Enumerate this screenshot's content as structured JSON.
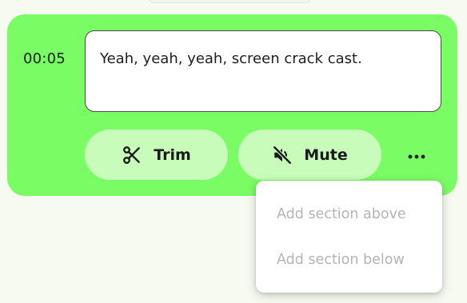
{
  "segment": {
    "timestamp": "00:05",
    "transcript": "Yeah, yeah, yeah, screen crack cast."
  },
  "actions": {
    "trim_label": "Trim",
    "trim_icon": "scissors-icon",
    "mute_label": "Mute",
    "mute_icon": "volume-muted-icon",
    "more_icon": "more-horizontal-icon"
  },
  "menu": {
    "items": [
      {
        "label": "Add section above",
        "disabled": true
      },
      {
        "label": "Add section below",
        "disabled": true
      }
    ]
  },
  "colors": {
    "card_background": "#7afc64",
    "pill_background": "#c8fcba",
    "disabled_text": "#b3b3b3"
  }
}
